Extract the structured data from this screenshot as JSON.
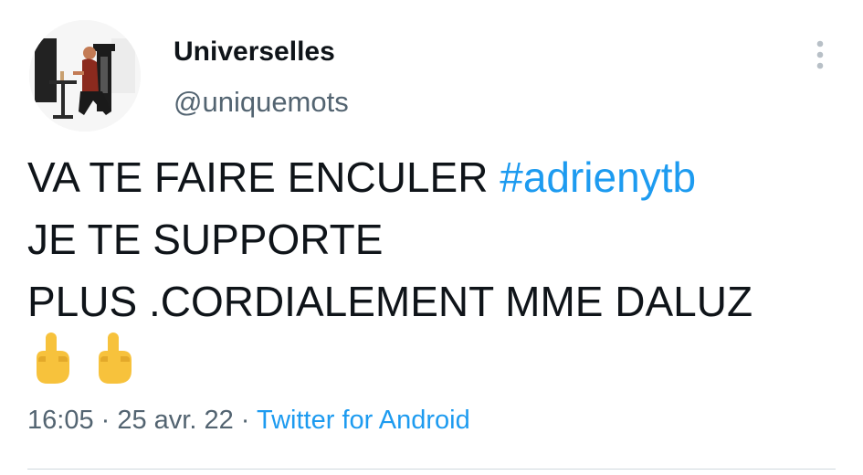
{
  "tweet": {
    "author": {
      "display_name": "Universelles",
      "handle": "@uniquemots",
      "avatar_icon": "avatar-photo-woman-seated-icon"
    },
    "more_icon": "more-vertical-icon",
    "text_lines": [
      {
        "text": "VA TE FAIRE ENCULER ",
        "hashtag": "#adrienytb"
      },
      {
        "text": "JE TE SUPPORTE"
      },
      {
        "text": "PLUS .CORDIALEMENT MME DALUZ"
      }
    ],
    "emojis": [
      "middle-finger-emoji-icon",
      "middle-finger-emoji-icon"
    ],
    "meta": {
      "time": "16:05",
      "separator": " · ",
      "date": "25 avr. 22",
      "source": "Twitter for Android"
    }
  },
  "colors": {
    "link": "#1d9bf0",
    "secondary_text": "#536471",
    "primary_text": "#0f1419",
    "divider": "#cfd9de"
  }
}
